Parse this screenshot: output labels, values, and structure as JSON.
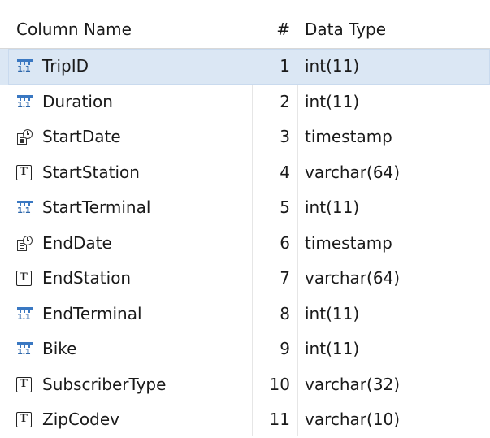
{
  "table": {
    "headers": {
      "name": "Column Name",
      "number": "#",
      "type": "Data Type"
    },
    "rows": [
      {
        "name": "TripID",
        "number": "1",
        "type": "int(11)",
        "icon": "numeric-column-icon",
        "selected": true
      },
      {
        "name": "Duration",
        "number": "2",
        "type": "int(11)",
        "icon": "numeric-column-icon"
      },
      {
        "name": "StartDate",
        "number": "3",
        "type": "timestamp",
        "icon": "timestamp-column-icon"
      },
      {
        "name": "StartStation",
        "number": "4",
        "type": "varchar(64)",
        "icon": "text-column-icon"
      },
      {
        "name": "StartTerminal",
        "number": "5",
        "type": "int(11)",
        "icon": "numeric-column-icon"
      },
      {
        "name": "EndDate",
        "number": "6",
        "type": "timestamp",
        "icon": "timestamp-column-icon"
      },
      {
        "name": "EndStation",
        "number": "7",
        "type": "varchar(64)",
        "icon": "text-column-icon"
      },
      {
        "name": "EndTerminal",
        "number": "8",
        "type": "int(11)",
        "icon": "numeric-column-icon"
      },
      {
        "name": "Bike",
        "number": "9",
        "type": "int(11)",
        "icon": "numeric-column-icon"
      },
      {
        "name": "SubscriberType",
        "number": "10",
        "type": "varchar(32)",
        "icon": "text-column-icon"
      },
      {
        "name": "ZipCodev",
        "number": "11",
        "type": "varchar(10)",
        "icon": "text-column-icon"
      }
    ]
  },
  "colors": {
    "selected_row": "#dbe7f4",
    "numeric_icon": "#3a78c2",
    "divider": "#e6e6e6"
  }
}
